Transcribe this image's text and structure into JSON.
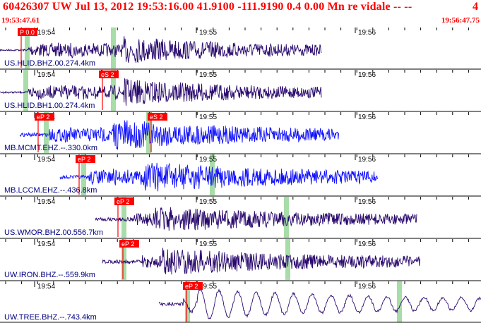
{
  "header": {
    "title": "60426307 UW Jul 13, 2012 19:53:16.00   41.9100 -111.9190  0.4 0.00 Mn re vidale -- --",
    "title_right": "4",
    "start_time": "19:53:47.61",
    "end_time": "19:56:47.75"
  },
  "colors": {
    "header_text": "#ff0000",
    "trace_dark": "#2a0a6e",
    "trace_blue": "#1010ff",
    "pick_color": "#ff0000",
    "window_color": "#a8dca8",
    "label_color": "#000080"
  },
  "time_axis": {
    "tick_labels": [
      "19:54",
      "19:55",
      "19:56"
    ]
  },
  "channels": [
    {
      "label": "US.HLID.BHZ.00.274.4km",
      "color": "dark",
      "picks": [
        {
          "label": "P 0.0"
        }
      ],
      "ticks": [
        "19:54",
        "19:55",
        "19:56"
      ]
    },
    {
      "label": "US.HLID.BH1.00.274.4km",
      "color": "dark",
      "picks": [
        {
          "label": "eS 2"
        }
      ],
      "ticks": [
        "19:54",
        "19:55",
        "19:56"
      ]
    },
    {
      "label": "MB.MCMT.EHZ.--.330.0km",
      "color": "blue",
      "picks": [
        {
          "label": "eP 2"
        },
        {
          "label": "eS 2"
        }
      ],
      "ticks": [
        "19:54",
        "19:55",
        "19:56"
      ]
    },
    {
      "label": "MB.LCCM.EHZ.--.436.8km",
      "color": "blue",
      "picks": [
        {
          "label": "eP 2"
        }
      ],
      "ticks": [
        "19:54",
        "19:55",
        "19:56"
      ]
    },
    {
      "label": "US.WMOR.BHZ.00.556.7km",
      "color": "dark",
      "picks": [
        {
          "label": "eP 2"
        }
      ],
      "ticks": [
        "19:54",
        "19:55",
        "19:56"
      ]
    },
    {
      "label": "UW.IRON.BHZ.--.559.9km",
      "color": "dark",
      "picks": [
        {
          "label": "eP 2"
        }
      ],
      "ticks": [
        "19:54",
        "19:55",
        "19:56"
      ]
    },
    {
      "label": "UW.TREE.BHZ.--.743.4km",
      "color": "dark",
      "picks": [
        {
          "label": "eP 2"
        }
      ],
      "ticks": [
        "19:54",
        "19:55",
        "19:56"
      ]
    }
  ]
}
